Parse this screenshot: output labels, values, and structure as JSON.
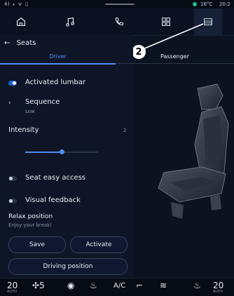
{
  "status": {
    "signals": "4l ⁎ ᯤ ▯",
    "temperature": "16°C",
    "time": "20:2"
  },
  "nav": {
    "icons": [
      "home-icon",
      "music-icon",
      "phone-icon",
      "apps-icon",
      "seat-settings-icon"
    ],
    "active": 4
  },
  "header": {
    "back": "←",
    "title": "Seats"
  },
  "tabs": {
    "driver": "Driver",
    "passenger": "Passenger"
  },
  "options": {
    "lumbar": "Activated lumbar",
    "sequence_label": "Sequence",
    "sequence_value": "Low",
    "intensity_label": "Intensity",
    "intensity_value": "2",
    "intensity_level": 0.5,
    "seat_easy_access": "Seat easy access",
    "visual_feedback": "Visual feedback",
    "relax_title": "Relax position",
    "relax_sub": "Enjoy your break!",
    "save": "Save",
    "activate": "Activate",
    "driving_position": "Driving position"
  },
  "callout": "2",
  "bottom": {
    "left_temp": "20",
    "left_temp_sub": "AUTO",
    "fan": "5",
    "ac": "A/C",
    "right_temp": "20",
    "right_temp_sub": "AUTO"
  },
  "colors": {
    "accent": "#4f8df0",
    "background": "#0b1220"
  }
}
